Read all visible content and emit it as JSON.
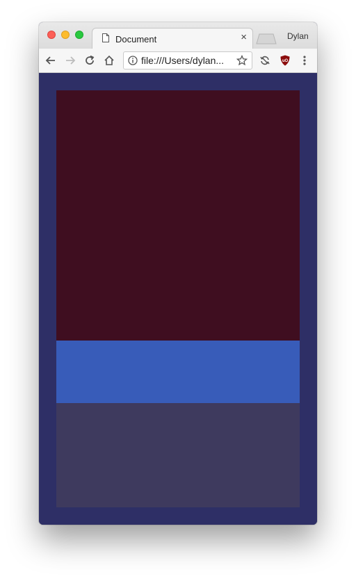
{
  "window": {
    "tab_title": "Document",
    "tab_close": "×",
    "profile_name": "Dylan"
  },
  "toolbar": {
    "url": "file:///Users/dylan..."
  },
  "icons": {
    "back": "back-arrow-icon",
    "forward": "forward-arrow-icon",
    "reload": "reload-icon",
    "home": "home-icon",
    "info": "info-icon",
    "bookmark": "star-icon",
    "sync": "sync-extension-icon",
    "ublock": "ublock-origin-icon",
    "menu": "kebab-menu-icon"
  },
  "colors": {
    "page_background": "#2e2f66",
    "block_top": "#3f0e20",
    "block_middle": "#385cb9",
    "block_bottom": "#3e3a5e"
  }
}
